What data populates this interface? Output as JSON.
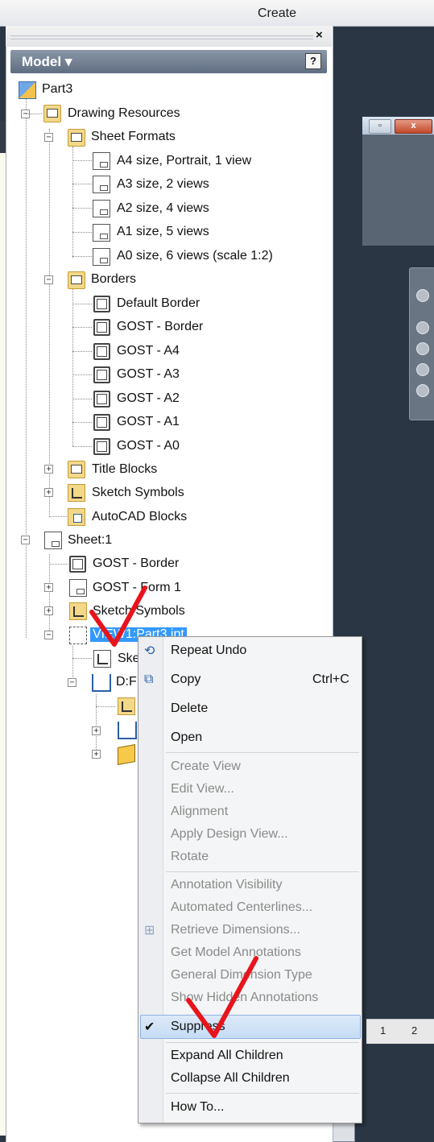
{
  "ribbon": {
    "create_label": "Create"
  },
  "panel": {
    "title": "Model ▾",
    "help": "?",
    "close": "×"
  },
  "tree": {
    "part": "Part3",
    "drawing_resources": "Drawing Resources",
    "sheet_formats": "Sheet Formats",
    "formats": [
      "A4 size, Portrait, 1 view",
      "A3 size, 2 views",
      "A2 size, 4 views",
      "A1 size, 5 views",
      "A0 size, 6 views (scale 1:2)"
    ],
    "borders": "Borders",
    "border_items": [
      "Default Border",
      "GOST - Border",
      "GOST - A4",
      "GOST - A3",
      "GOST - A2",
      "GOST - A1",
      "GOST - A0"
    ],
    "title_blocks": "Title Blocks",
    "sketch_symbols": "Sketch Symbols",
    "autocad_blocks": "AutoCAD Blocks",
    "sheet": "Sheet:1",
    "sheet_border": "GOST - Border",
    "sheet_form": "GOST - Form 1",
    "sheet_sketch_symbols": "Sketch Symbols",
    "view": "VIEW1:Part3.ipt",
    "view_sketch": "Ske",
    "view_dim": "D:F"
  },
  "menu": {
    "items": [
      {
        "label": "Repeat Undo",
        "enabled": true
      },
      {
        "label": "Copy",
        "enabled": true,
        "shortcut": "Ctrl+C"
      },
      {
        "label": "Delete",
        "enabled": true
      },
      {
        "label": "Open",
        "enabled": true
      },
      {
        "label": "Create View",
        "enabled": false
      },
      {
        "label": "Edit View...",
        "enabled": false
      },
      {
        "label": "Alignment",
        "enabled": false
      },
      {
        "label": "Apply Design View...",
        "enabled": false
      },
      {
        "label": "Rotate",
        "enabled": false
      },
      {
        "label": "Annotation Visibility",
        "enabled": false
      },
      {
        "label": "Automated Centerlines...",
        "enabled": false
      },
      {
        "label": "Retrieve Dimensions...",
        "enabled": false
      },
      {
        "label": "Get Model Annotations",
        "enabled": false
      },
      {
        "label": "General Dimension Type",
        "enabled": false
      },
      {
        "label": "Show Hidden Annotations",
        "enabled": false
      },
      {
        "label": "Suppress",
        "enabled": true,
        "checked": true
      },
      {
        "label": "Expand All Children",
        "enabled": true
      },
      {
        "label": "Collapse All Children",
        "enabled": true
      },
      {
        "label": "How To...",
        "enabled": true
      }
    ]
  },
  "statusbar": {
    "pages": [
      "1",
      "2"
    ]
  },
  "colors": {
    "selection": "#3399ff",
    "annotation": "#e8141b",
    "panel_header": "#6f7d90"
  }
}
